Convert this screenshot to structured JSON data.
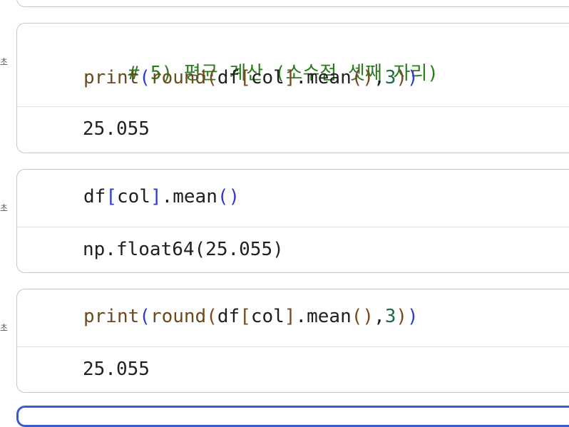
{
  "gutter": {
    "cell1_label": "초",
    "cell2_label": "초",
    "cell3_label": "초"
  },
  "cells": [
    {
      "code_lines": [
        "# 5) 평균 계산 (소수점 셋째 자리)",
        "print(round(df[col].mean(),3))"
      ],
      "output": "25.055"
    },
    {
      "code_lines": [
        "df[col].mean()"
      ],
      "output": "np.float64(25.055)"
    },
    {
      "code_lines": [
        "print(round(df[col].mean(),3))"
      ],
      "output": "25.055"
    }
  ],
  "tokens": {
    "print": "print",
    "round": "round",
    "df": "df",
    "col": "col",
    "mean": "mean",
    "three": "3",
    "dot": ".",
    "comma": ",",
    "lparen": "(",
    "rparen": ")",
    "lbrack": "[",
    "rbrack": "]"
  },
  "colors": {
    "comment": "#2c7a1f",
    "function": "#6a4a1e",
    "paren_outer": "#2f3bd6",
    "number": "#216a45",
    "cell_border": "#c7c7c7",
    "focused_cell_border": "#3b5bd1"
  }
}
